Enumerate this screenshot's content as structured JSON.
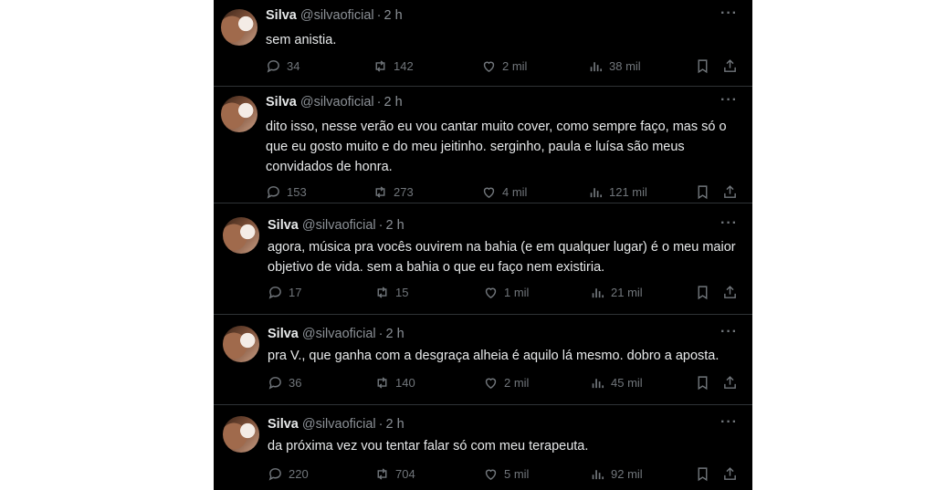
{
  "tweets": [
    {
      "name": "Silva",
      "handle": "@silvaoficial",
      "dot": "·",
      "time": "2 h",
      "text": "sem anistia.",
      "replies": "34",
      "reposts": "142",
      "likes": "2 mil",
      "views": "38 mil"
    },
    {
      "name": "Silva",
      "handle": "@silvaoficial",
      "dot": "·",
      "time": "2 h",
      "text": "dito isso, nesse verão eu vou cantar muito cover, como sempre faço, mas só o que eu gosto muito e do meu jeitinho. serginho, paula e luísa são meus convidados de honra.",
      "replies": "153",
      "reposts": "273",
      "likes": "4 mil",
      "views": "121 mil"
    },
    {
      "name": "Silva",
      "handle": "@silvaoficial",
      "dot": "·",
      "time": "2 h",
      "text": "agora, música pra vocês ouvirem na bahia (e em qualquer lugar) é o meu maior objetivo de vida. sem a bahia o que eu faço nem existiria.",
      "replies": "17",
      "reposts": "15",
      "likes": "1 mil",
      "views": "21 mil"
    },
    {
      "name": "Silva",
      "handle": "@silvaoficial",
      "dot": "·",
      "time": "2 h",
      "text": "pra V., que ganha com a desgraça alheia é aquilo lá mesmo. dobro a aposta.",
      "replies": "36",
      "reposts": "140",
      "likes": "2 mil",
      "views": "45 mil"
    },
    {
      "name": "Silva",
      "handle": "@silvaoficial",
      "dot": "·",
      "time": "2 h",
      "text": "da próxima vez vou tentar falar só com meu terapeuta.",
      "replies": "220",
      "reposts": "704",
      "likes": "5 mil",
      "views": "92 mil"
    }
  ],
  "more_glyph": "···",
  "icons": [
    "reply-icon",
    "repost-icon",
    "like-icon",
    "views-icon",
    "bookmark-icon",
    "share-icon",
    "more-icon"
  ]
}
